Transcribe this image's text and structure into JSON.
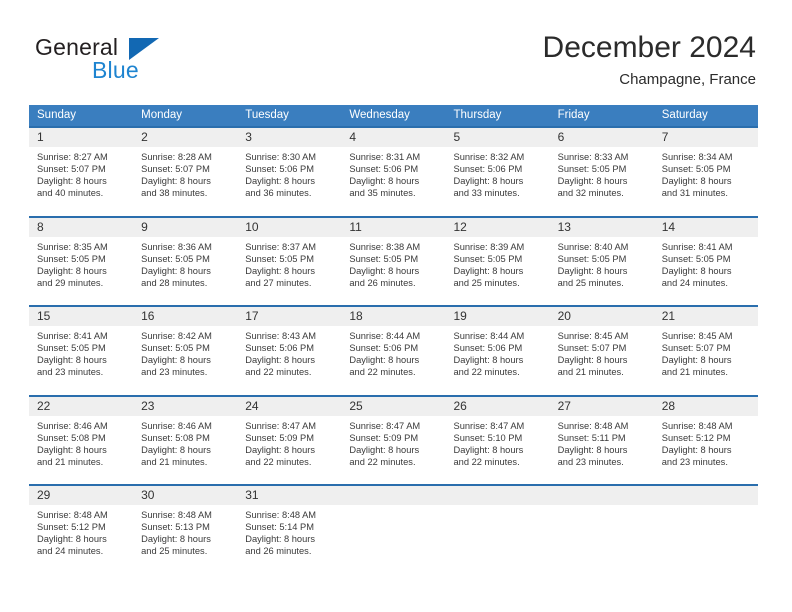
{
  "brand": {
    "name_top": "General",
    "name_bottom": "Blue",
    "color_dark": "#231f20",
    "color_blue": "#1e84d0",
    "triangle_color": "#1268b3"
  },
  "header": {
    "title": "December 2024",
    "subtitle": "Champagne, France"
  },
  "theme": {
    "header_row_bg": "#3a7ebf",
    "cell_rule": "#2a6ead",
    "daynum_band": "#efefef",
    "text": "#3a3a3a"
  },
  "weekdays": [
    "Sunday",
    "Monday",
    "Tuesday",
    "Wednesday",
    "Thursday",
    "Friday",
    "Saturday"
  ],
  "weeks": [
    [
      {
        "day": "1",
        "sunrise": "Sunrise: 8:27 AM",
        "sunset": "Sunset: 5:07 PM",
        "daylight1": "Daylight: 8 hours",
        "daylight2": "and 40 minutes."
      },
      {
        "day": "2",
        "sunrise": "Sunrise: 8:28 AM",
        "sunset": "Sunset: 5:07 PM",
        "daylight1": "Daylight: 8 hours",
        "daylight2": "and 38 minutes."
      },
      {
        "day": "3",
        "sunrise": "Sunrise: 8:30 AM",
        "sunset": "Sunset: 5:06 PM",
        "daylight1": "Daylight: 8 hours",
        "daylight2": "and 36 minutes."
      },
      {
        "day": "4",
        "sunrise": "Sunrise: 8:31 AM",
        "sunset": "Sunset: 5:06 PM",
        "daylight1": "Daylight: 8 hours",
        "daylight2": "and 35 minutes."
      },
      {
        "day": "5",
        "sunrise": "Sunrise: 8:32 AM",
        "sunset": "Sunset: 5:06 PM",
        "daylight1": "Daylight: 8 hours",
        "daylight2": "and 33 minutes."
      },
      {
        "day": "6",
        "sunrise": "Sunrise: 8:33 AM",
        "sunset": "Sunset: 5:05 PM",
        "daylight1": "Daylight: 8 hours",
        "daylight2": "and 32 minutes."
      },
      {
        "day": "7",
        "sunrise": "Sunrise: 8:34 AM",
        "sunset": "Sunset: 5:05 PM",
        "daylight1": "Daylight: 8 hours",
        "daylight2": "and 31 minutes."
      }
    ],
    [
      {
        "day": "8",
        "sunrise": "Sunrise: 8:35 AM",
        "sunset": "Sunset: 5:05 PM",
        "daylight1": "Daylight: 8 hours",
        "daylight2": "and 29 minutes."
      },
      {
        "day": "9",
        "sunrise": "Sunrise: 8:36 AM",
        "sunset": "Sunset: 5:05 PM",
        "daylight1": "Daylight: 8 hours",
        "daylight2": "and 28 minutes."
      },
      {
        "day": "10",
        "sunrise": "Sunrise: 8:37 AM",
        "sunset": "Sunset: 5:05 PM",
        "daylight1": "Daylight: 8 hours",
        "daylight2": "and 27 minutes."
      },
      {
        "day": "11",
        "sunrise": "Sunrise: 8:38 AM",
        "sunset": "Sunset: 5:05 PM",
        "daylight1": "Daylight: 8 hours",
        "daylight2": "and 26 minutes."
      },
      {
        "day": "12",
        "sunrise": "Sunrise: 8:39 AM",
        "sunset": "Sunset: 5:05 PM",
        "daylight1": "Daylight: 8 hours",
        "daylight2": "and 25 minutes."
      },
      {
        "day": "13",
        "sunrise": "Sunrise: 8:40 AM",
        "sunset": "Sunset: 5:05 PM",
        "daylight1": "Daylight: 8 hours",
        "daylight2": "and 25 minutes."
      },
      {
        "day": "14",
        "sunrise": "Sunrise: 8:41 AM",
        "sunset": "Sunset: 5:05 PM",
        "daylight1": "Daylight: 8 hours",
        "daylight2": "and 24 minutes."
      }
    ],
    [
      {
        "day": "15",
        "sunrise": "Sunrise: 8:41 AM",
        "sunset": "Sunset: 5:05 PM",
        "daylight1": "Daylight: 8 hours",
        "daylight2": "and 23 minutes."
      },
      {
        "day": "16",
        "sunrise": "Sunrise: 8:42 AM",
        "sunset": "Sunset: 5:05 PM",
        "daylight1": "Daylight: 8 hours",
        "daylight2": "and 23 minutes."
      },
      {
        "day": "17",
        "sunrise": "Sunrise: 8:43 AM",
        "sunset": "Sunset: 5:06 PM",
        "daylight1": "Daylight: 8 hours",
        "daylight2": "and 22 minutes."
      },
      {
        "day": "18",
        "sunrise": "Sunrise: 8:44 AM",
        "sunset": "Sunset: 5:06 PM",
        "daylight1": "Daylight: 8 hours",
        "daylight2": "and 22 minutes."
      },
      {
        "day": "19",
        "sunrise": "Sunrise: 8:44 AM",
        "sunset": "Sunset: 5:06 PM",
        "daylight1": "Daylight: 8 hours",
        "daylight2": "and 22 minutes."
      },
      {
        "day": "20",
        "sunrise": "Sunrise: 8:45 AM",
        "sunset": "Sunset: 5:07 PM",
        "daylight1": "Daylight: 8 hours",
        "daylight2": "and 21 minutes."
      },
      {
        "day": "21",
        "sunrise": "Sunrise: 8:45 AM",
        "sunset": "Sunset: 5:07 PM",
        "daylight1": "Daylight: 8 hours",
        "daylight2": "and 21 minutes."
      }
    ],
    [
      {
        "day": "22",
        "sunrise": "Sunrise: 8:46 AM",
        "sunset": "Sunset: 5:08 PM",
        "daylight1": "Daylight: 8 hours",
        "daylight2": "and 21 minutes."
      },
      {
        "day": "23",
        "sunrise": "Sunrise: 8:46 AM",
        "sunset": "Sunset: 5:08 PM",
        "daylight1": "Daylight: 8 hours",
        "daylight2": "and 21 minutes."
      },
      {
        "day": "24",
        "sunrise": "Sunrise: 8:47 AM",
        "sunset": "Sunset: 5:09 PM",
        "daylight1": "Daylight: 8 hours",
        "daylight2": "and 22 minutes."
      },
      {
        "day": "25",
        "sunrise": "Sunrise: 8:47 AM",
        "sunset": "Sunset: 5:09 PM",
        "daylight1": "Daylight: 8 hours",
        "daylight2": "and 22 minutes."
      },
      {
        "day": "26",
        "sunrise": "Sunrise: 8:47 AM",
        "sunset": "Sunset: 5:10 PM",
        "daylight1": "Daylight: 8 hours",
        "daylight2": "and 22 minutes."
      },
      {
        "day": "27",
        "sunrise": "Sunrise: 8:48 AM",
        "sunset": "Sunset: 5:11 PM",
        "daylight1": "Daylight: 8 hours",
        "daylight2": "and 23 minutes."
      },
      {
        "day": "28",
        "sunrise": "Sunrise: 8:48 AM",
        "sunset": "Sunset: 5:12 PM",
        "daylight1": "Daylight: 8 hours",
        "daylight2": "and 23 minutes."
      }
    ],
    [
      {
        "day": "29",
        "sunrise": "Sunrise: 8:48 AM",
        "sunset": "Sunset: 5:12 PM",
        "daylight1": "Daylight: 8 hours",
        "daylight2": "and 24 minutes."
      },
      {
        "day": "30",
        "sunrise": "Sunrise: 8:48 AM",
        "sunset": "Sunset: 5:13 PM",
        "daylight1": "Daylight: 8 hours",
        "daylight2": "and 25 minutes."
      },
      {
        "day": "31",
        "sunrise": "Sunrise: 8:48 AM",
        "sunset": "Sunset: 5:14 PM",
        "daylight1": "Daylight: 8 hours",
        "daylight2": "and 26 minutes."
      },
      {
        "day": "",
        "sunrise": "",
        "sunset": "",
        "daylight1": "",
        "daylight2": ""
      },
      {
        "day": "",
        "sunrise": "",
        "sunset": "",
        "daylight1": "",
        "daylight2": ""
      },
      {
        "day": "",
        "sunrise": "",
        "sunset": "",
        "daylight1": "",
        "daylight2": ""
      },
      {
        "day": "",
        "sunrise": "",
        "sunset": "",
        "daylight1": "",
        "daylight2": ""
      }
    ]
  ]
}
